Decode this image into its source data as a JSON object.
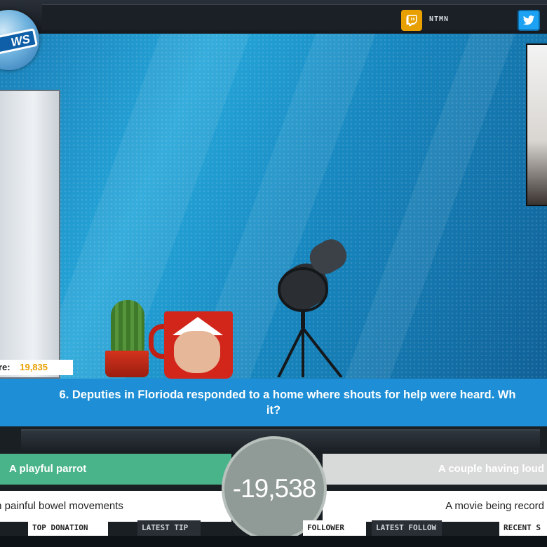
{
  "header": {
    "channel_name": "NTMN",
    "icons": [
      "twitch-icon",
      "twitter-icon"
    ]
  },
  "logo": {
    "text": "WS"
  },
  "game": {
    "score_label": "re:",
    "score_value": "19,835"
  },
  "question": {
    "line1": "6. Deputies in Florioda responded to a home where shouts for help were heard. Wh",
    "line2": "it?"
  },
  "answers": [
    {
      "text": "A playful parrot"
    },
    {
      "text": "A couple having loud"
    },
    {
      "text": "th painful bowel movements"
    },
    {
      "text": "A movie being record"
    }
  ],
  "timer": {
    "value": "-19,538"
  },
  "bottom_labels": [
    {
      "text": "TOP DONATION"
    },
    {
      "text": "LATEST TIP"
    },
    {
      "text": "FOLLOWER"
    },
    {
      "text": "LATEST FOLLOW"
    },
    {
      "text": "RECENT S"
    }
  ],
  "colors": {
    "question_bar": "#1e8fd6",
    "answer_correct": "#49b48a",
    "answer_neutral": "#d8dad9",
    "timer": "#909a96",
    "score_accent": "#e8a000",
    "twitch": "#e8a000",
    "twitter": "#1da1f2"
  }
}
